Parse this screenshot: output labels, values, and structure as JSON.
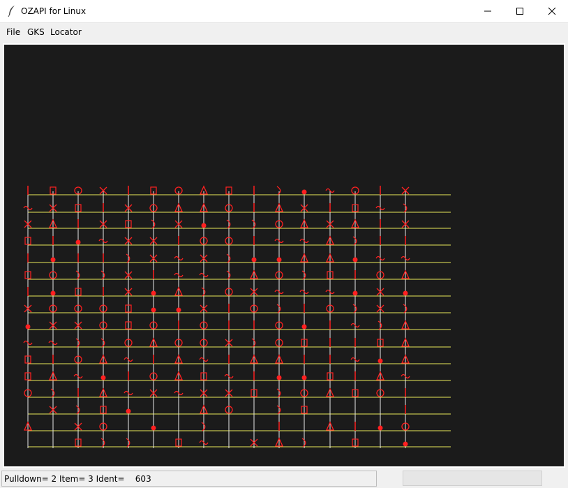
{
  "window": {
    "title": "OZAPI for Linux",
    "icon": "feather-icon",
    "controls": [
      "minimize-icon",
      "maximize-icon",
      "close-icon"
    ]
  },
  "menu": {
    "items": [
      "File",
      "GKS",
      "Locator"
    ]
  },
  "canvas": {
    "background": "#1b1b1b",
    "line_color": "#e8e85a",
    "glyph_color": "#ff2020"
  },
  "status": {
    "text": "Pulldown= 2 Item= 3 Ident=    603"
  }
}
